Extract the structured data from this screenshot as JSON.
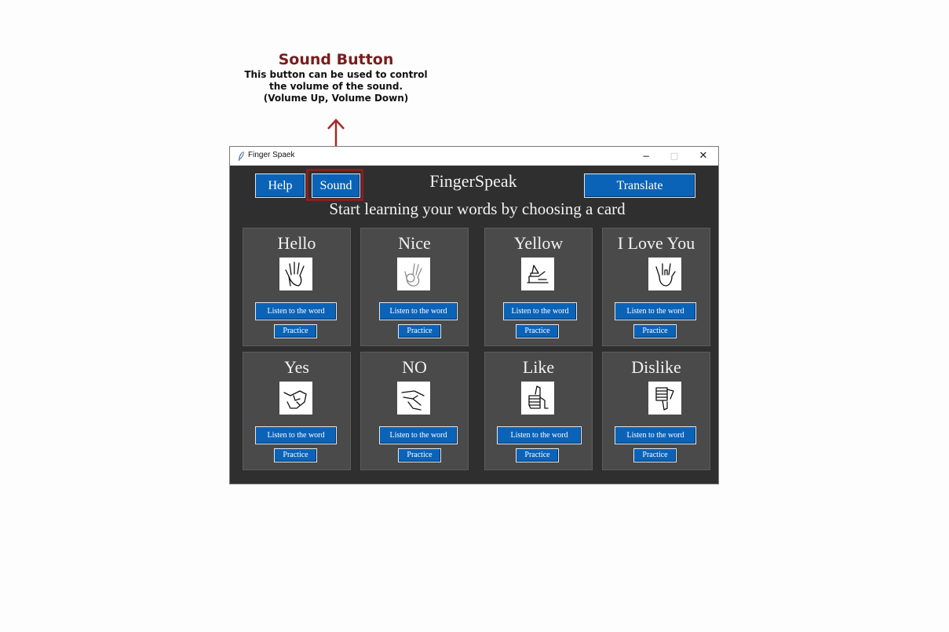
{
  "annotation": {
    "title": "Sound Button",
    "lines": [
      "This button can be used to control",
      "the volume of the sound.",
      "(Volume Up, Volume Down)"
    ],
    "color": "#7b1c1c"
  },
  "window": {
    "title": "Finger Spaek",
    "controls": {
      "minimize": "−",
      "maximize": "□",
      "close": "✕"
    }
  },
  "toolbar": {
    "help_label": "Help",
    "sound_label": "Sound",
    "translate_label": "Translate"
  },
  "header": {
    "app_title": "FingerSpeak",
    "subtitle": "Start learning your words by choosing a card"
  },
  "cards": [
    {
      "word": "Hello",
      "icon": "open-hand-icon",
      "listen_label": "Listen to the word",
      "practice_label": "Practice"
    },
    {
      "word": "Nice",
      "icon": "ok-hand-icon",
      "listen_label": "Listen to the word",
      "practice_label": "Practice"
    },
    {
      "word": "Yellow",
      "icon": "shaka-hand-icon",
      "listen_label": "Listen to the word",
      "practice_label": "Practice"
    },
    {
      "word": "I Love You",
      "icon": "ily-hand-icon",
      "listen_label": "Listen to the word",
      "practice_label": "Practice"
    },
    {
      "word": "Yes",
      "icon": "fist-hand-icon",
      "listen_label": "Listen to the word",
      "practice_label": "Practice"
    },
    {
      "word": "NO",
      "icon": "no-hand-icon",
      "listen_label": "Listen to the word",
      "practice_label": "Practice"
    },
    {
      "word": "Like",
      "icon": "thumbs-up-icon",
      "listen_label": "Listen to the word",
      "practice_label": "Practice"
    },
    {
      "word": "Dislike",
      "icon": "thumbs-down-icon",
      "listen_label": "Listen to the word",
      "practice_label": "Practice"
    }
  ],
  "colors": {
    "window_bg": "#2f2f2f",
    "card_bg": "#4a4a4a",
    "button_bg": "#0b63b8",
    "highlight": "#8b1e1e"
  }
}
